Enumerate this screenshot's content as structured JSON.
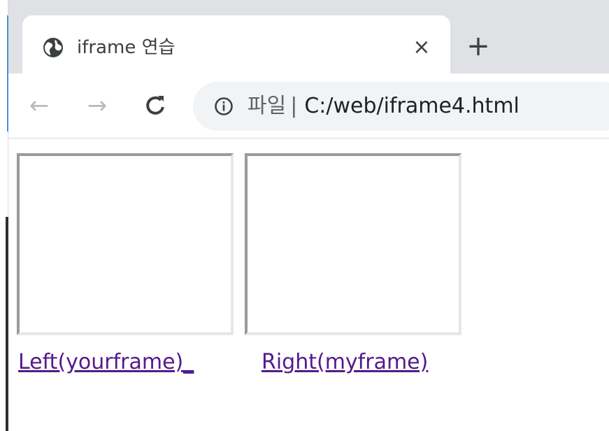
{
  "tab": {
    "title": "iframe 연습",
    "close_glyph": "×",
    "favicon": "globe-icon"
  },
  "tabstrip": {
    "new_tab_glyph": "+"
  },
  "toolbar": {
    "back_glyph": "←",
    "forward_glyph": "→",
    "reload_glyph": "C",
    "info_icon": "info-icon",
    "url_scheme": "파일",
    "url_separator": "|",
    "url": "C:/web/iframe4.html"
  },
  "content": {
    "left_link": "Left(yourframe)_",
    "right_link": "Right(myframe)"
  },
  "colors": {
    "tabstrip_bg": "#dfe1e5",
    "omnibox_bg": "#f1f3f4",
    "visited_link": "#551a8b",
    "frame_border_dark": "#9a9a9a",
    "frame_border_light": "#e6e6e6"
  }
}
